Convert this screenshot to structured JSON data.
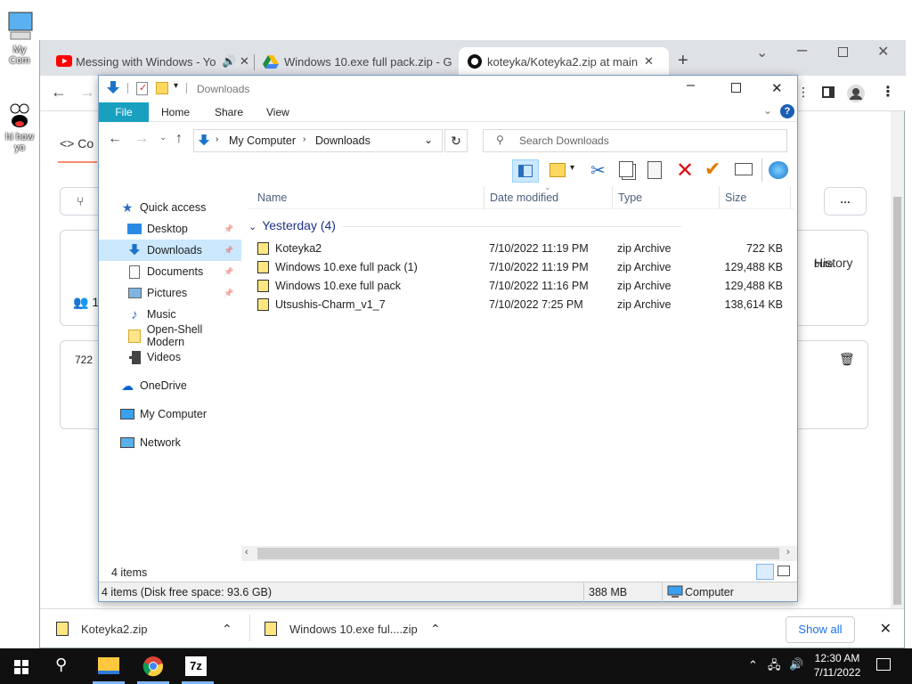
{
  "desktop": {
    "icons": [
      {
        "label": "My Com"
      },
      {
        "label": "hi how yo"
      }
    ]
  },
  "browser": {
    "tabs": [
      {
        "title": "Messing with Windows - Yo",
        "icon": "youtube-icon"
      },
      {
        "title": "Windows 10.exe full pack.zip - G",
        "icon": "google-drive-icon"
      },
      {
        "title": "koteyka/Koteyka2.zip at main",
        "icon": "github-icon"
      }
    ],
    "page": {
      "code_tab": "<> Co",
      "history": "History",
      "users_count": "1",
      "file_lines": "722",
      "bute": "bute"
    },
    "downloads": [
      {
        "name": "Koteyka2.zip"
      },
      {
        "name": "Windows 10.exe ful....zip"
      }
    ],
    "show_all": "Show all"
  },
  "explorer": {
    "title": "Downloads",
    "ribbon_tabs": [
      "File",
      "Home",
      "Share",
      "View"
    ],
    "address": {
      "segments": [
        "My Computer",
        "Downloads"
      ]
    },
    "search_placeholder": "Search Downloads",
    "nav": [
      {
        "label": "Quick access",
        "icon": "star-icon"
      },
      {
        "label": "Desktop",
        "icon": "desktop-icon",
        "pinned": true
      },
      {
        "label": "Downloads",
        "icon": "download-arrow-icon",
        "pinned": true,
        "selected": true
      },
      {
        "label": "Documents",
        "icon": "documents-icon",
        "pinned": true
      },
      {
        "label": "Pictures",
        "icon": "pictures-icon",
        "pinned": true
      },
      {
        "label": "Music",
        "icon": "music-icon"
      },
      {
        "label": "Open-Shell Modern",
        "icon": "folder-icon"
      },
      {
        "label": "Videos",
        "icon": "videos-icon"
      },
      {
        "label": "OneDrive",
        "icon": "cloud-icon"
      },
      {
        "label": "My Computer",
        "icon": "computer-icon"
      },
      {
        "label": "Network",
        "icon": "network-icon"
      }
    ],
    "columns": [
      "Name",
      "Date modified",
      "Type",
      "Size"
    ],
    "group": "Yesterday (4)",
    "files": [
      {
        "name": "Koteyka2",
        "date": "7/10/2022 11:19 PM",
        "type": "zip Archive",
        "size": "722 KB"
      },
      {
        "name": "Windows 10.exe full pack (1)",
        "date": "7/10/2022 11:19 PM",
        "type": "zip Archive",
        "size": "129,488 KB"
      },
      {
        "name": "Windows 10.exe full pack",
        "date": "7/10/2022 11:16 PM",
        "type": "zip Archive",
        "size": "129,488 KB"
      },
      {
        "name": "Utsushis-Charm_v1_7",
        "date": "7/10/2022 7:25 PM",
        "type": "zip Archive",
        "size": "138,614 KB"
      }
    ],
    "item_count": "4 items",
    "status": {
      "left": "4 items (Disk free space: 93.6 GB)",
      "size": "388 MB",
      "location": "Computer"
    }
  },
  "taskbar": {
    "time": "12:30 AM",
    "date": "7/11/2022",
    "apps": [
      "file-explorer",
      "chrome",
      "7zip"
    ],
    "sevenzip_label": "7z"
  }
}
